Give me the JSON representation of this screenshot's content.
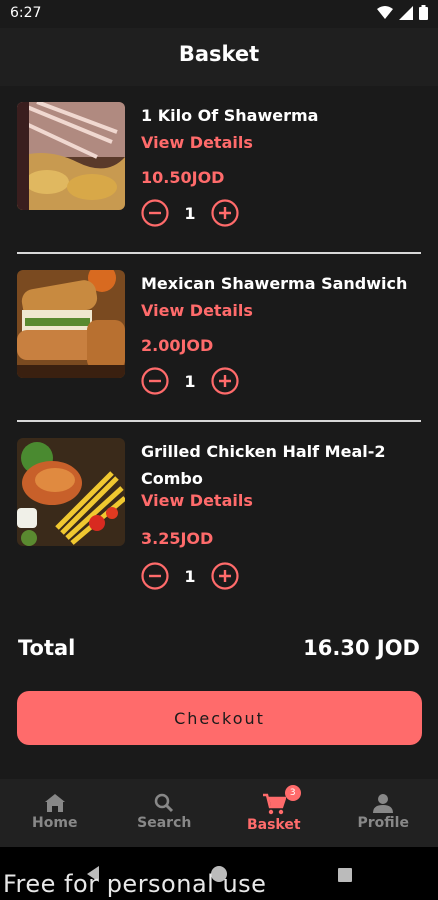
{
  "status_bar": {
    "time": "6:27"
  },
  "header": {
    "title": "Basket"
  },
  "items": [
    {
      "name": "1 Kilo Of Shawerma",
      "view_details": "View Details",
      "price": "10.50JOD",
      "quantity": "1"
    },
    {
      "name": "Mexican Shawerma Sandwich",
      "view_details": "View Details",
      "price": "2.00JOD",
      "quantity": "1"
    },
    {
      "name": "Grilled Chicken Half Meal-2 Combo",
      "view_details": "View Details",
      "price": "3.25JOD",
      "quantity": "1"
    }
  ],
  "summary": {
    "total_label": "Total",
    "total_value": "16.30 JOD"
  },
  "checkout_label": "Checkout",
  "nav": {
    "items": [
      {
        "label": "Home",
        "icon": "home-icon"
      },
      {
        "label": "Search",
        "icon": "search-icon"
      },
      {
        "label": "Basket",
        "icon": "cart-icon",
        "badge": "3"
      },
      {
        "label": "Profile",
        "icon": "person-icon"
      }
    ],
    "active": "Basket"
  },
  "watermark": "Free for personal use",
  "colors": {
    "accent": "#ff6b6b",
    "background": "#1a1a1a"
  }
}
